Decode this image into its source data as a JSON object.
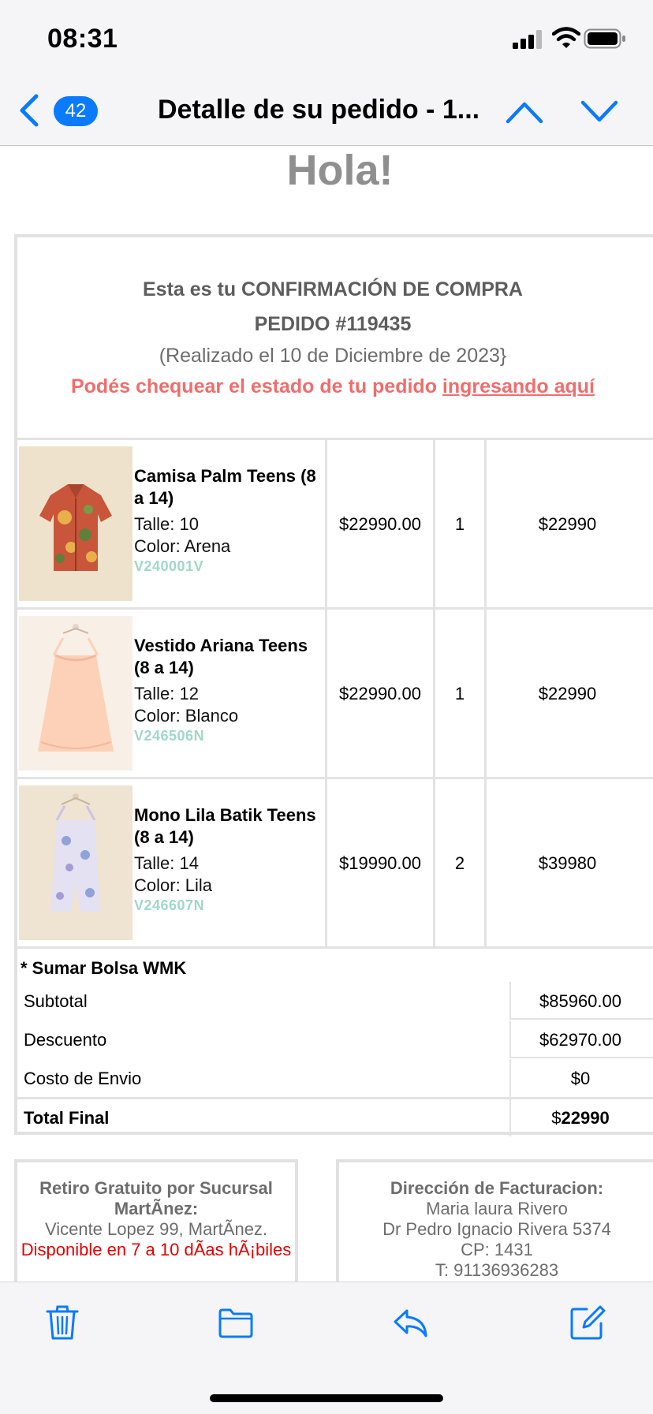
{
  "status_bar": {
    "time": "08:31"
  },
  "nav": {
    "unread_count": "42",
    "title": "Detalle de su pedido - 1..."
  },
  "email": {
    "greeting": "Hola!",
    "confirmation": {
      "line1": "Esta es tu CONFIRMACIÓN DE COMPRA",
      "line2": "PEDIDO #119435",
      "line3": "(Realizado el 10 de Diciembre de 2023}",
      "status_prefix": "Podés chequear el estado de tu pedido ",
      "status_link": "ingresando aquí"
    },
    "items": [
      {
        "name": "Camisa Palm Teens (8 a 14)",
        "size": "Talle: 10",
        "color": "Color: Arena",
        "sku": "V240001V",
        "price": "$22990.00",
        "qty": "1",
        "total": "$22990",
        "image": "shirt-image"
      },
      {
        "name": "Vestido Ariana Teens (8 a 14)",
        "size": "Talle: 12",
        "color": "Color: Blanco",
        "sku": "V246506N",
        "price": "$22990.00",
        "qty": "1",
        "total": "$22990",
        "image": "dress-image"
      },
      {
        "name": "Mono Lila Batik Teens (8 a 14)",
        "size": "Talle: 14",
        "color": "Color: Lila",
        "sku": "V246607N",
        "price": "$19990.00",
        "qty": "2",
        "total": "$39980",
        "image": "jumpsuit-image"
      }
    ],
    "extras": "* Sumar Bolsa WMK",
    "summary": {
      "subtotal_label": "Subtotal",
      "subtotal_value": "$85960.00",
      "discount_label": "Descuento",
      "discount_value": "$62970.00",
      "shipping_label": "Costo de Envio",
      "shipping_value": "$0",
      "total_label": "Total Final",
      "total_currency": "$",
      "total_value": "22990"
    },
    "pickup": {
      "title_1": "Retiro Gratuito por Sucursal",
      "title_2": "MartÃnez:",
      "address": "Vicente Lopez 99, MartÃnez.",
      "availability": "Disponible en 7 a 10 dÃas hÃ¡biles"
    },
    "billing": {
      "title": "Dirección de Facturacion:",
      "name": "Maria laura Rivero",
      "street": "Dr Pedro Ignacio Rivera 5374",
      "cp": "CP: 1431",
      "phone": "T: 91136936283"
    }
  },
  "toolbar": {
    "icons": [
      "trash-icon",
      "folder-icon",
      "reply-icon",
      "compose-icon"
    ]
  },
  "colors": {
    "accent": "#0a7aff",
    "link_red": "#f06d6d",
    "sku_green": "#9fd8c7",
    "alert_red": "#e50000"
  }
}
